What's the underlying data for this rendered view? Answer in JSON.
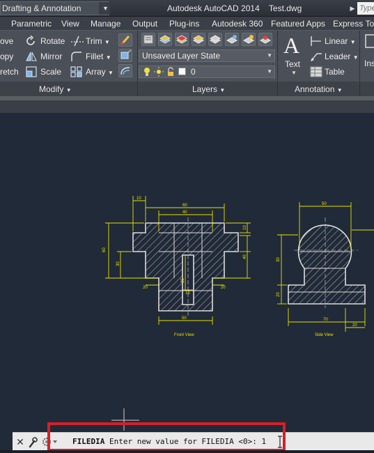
{
  "titlebar": {
    "workspace": "Drafting & Annotation",
    "app_name": "Autodesk AutoCAD 2014",
    "file_name": "Test.dwg",
    "search_placeholder": "Type"
  },
  "ribbon_tabs": [
    "Parametric",
    "View",
    "Manage",
    "Output",
    "Plug-ins",
    "Autodesk 360",
    "Featured Apps",
    "Express Tools"
  ],
  "modify_panel": {
    "title": "Modify",
    "items": [
      "ove",
      "Rotate",
      "Trim",
      "opy",
      "Mirror",
      "Fillet",
      "retch",
      "Scale",
      "Array"
    ]
  },
  "layers_panel": {
    "title": "Layers",
    "layer_state": "Unsaved Layer State",
    "current_layer": "0"
  },
  "annotation_panel": {
    "title": "Annotation",
    "text_label": "Text",
    "linear_label": "Linear",
    "leader_label": "Leader",
    "table_label": "Table",
    "insert_label": "Ins"
  },
  "drawing": {
    "front_view_caption": "Front View",
    "side_view_caption": "Side View",
    "dims": {
      "front_top_small": "10",
      "front_top_width": "60",
      "front_top_mid": "40",
      "front_left_height": "60",
      "front_left_inner": "30",
      "front_right_top": "10",
      "front_right_height": "40",
      "front_slot_depth": "35",
      "front_slot_width": "15",
      "front_step_left": "20",
      "front_step_right": "20",
      "front_bottom": "50",
      "side_top_width": "50",
      "side_left_height": "30",
      "side_base_height": "20",
      "side_bottom_width": "70",
      "side_bottom_right": "20"
    }
  },
  "command_line": {
    "command": "FILEDIA",
    "prompt": "Enter new value for FILEDIA <0>:",
    "input_value": "1"
  },
  "colors": {
    "canvas_bg": "#212a38",
    "geometry": "#dcdcdc",
    "dimensions": "#e8e000",
    "highlight_box": "#d81f26"
  }
}
